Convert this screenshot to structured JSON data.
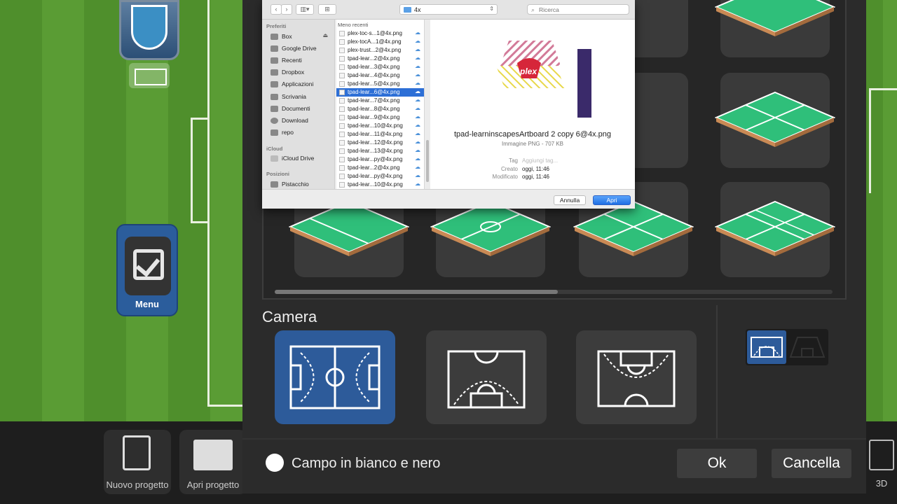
{
  "app": {
    "menu_label": "Menu",
    "new_project_label": "Nuovo progetto",
    "open_project_label": "Apri progetto",
    "view_3d_label": "3D"
  },
  "panel": {
    "camera_title": "Camera",
    "bw_field_label": "Campo in bianco e nero",
    "ok_label": "Ok",
    "cancel_label": "Cancella",
    "accent_color": "#2d5b9a"
  },
  "dialog": {
    "path_folder": "4x",
    "search_placeholder": "Ricerca",
    "sidebar": {
      "favorites_header": "Preferiti",
      "favorites": [
        "Box",
        "Google Drive",
        "Recenti",
        "Dropbox",
        "Applicazioni",
        "Scrivania",
        "Documenti",
        "Download",
        "repo"
      ],
      "icloud_header": "iCloud",
      "icloud": [
        "iCloud Drive"
      ],
      "places_header": "Posizioni",
      "places": [
        "Pistacchio"
      ]
    },
    "files_header": "Meno recenti",
    "files": [
      "plex-toc-s...1@4x.png",
      "plex-tocA...1@4x.png",
      "plex-trust...2@4x.png",
      "tpad-lear...2@4x.png",
      "tpad-lear...3@4x.png",
      "tpad-lear...4@4x.png",
      "tpad-lear...5@4x.png",
      "tpad-lear...6@4x.png",
      "tpad-lear...7@4x.png",
      "tpad-lear...8@4x.png",
      "tpad-lear...9@4x.png",
      "tpad-lear...10@4x.png",
      "tpad-lear...11@4x.png",
      "tpad-lear...12@4x.png",
      "tpad-lear...13@4x.png",
      "tpad-lear...py@4x.png",
      "tpad-lear...2@4x.png",
      "tpad-lear...py@4x.png",
      "tpad-lear...10@4x.png"
    ],
    "selected_index": 7,
    "preview": {
      "filename": "tpad-learninscapesArtboard 2 copy 6@4x.png",
      "kind": "Immagine PNG - 707 KB",
      "tag_label": "Tag",
      "tag_placeholder": "Aggiungi tag...",
      "created_label": "Creato",
      "created_value": "oggi, 11:46",
      "modified_label": "Modificato",
      "modified_value": "oggi, 11:46",
      "logo_text": "plex"
    },
    "cancel_label": "Annulla",
    "open_label": "Apri"
  }
}
